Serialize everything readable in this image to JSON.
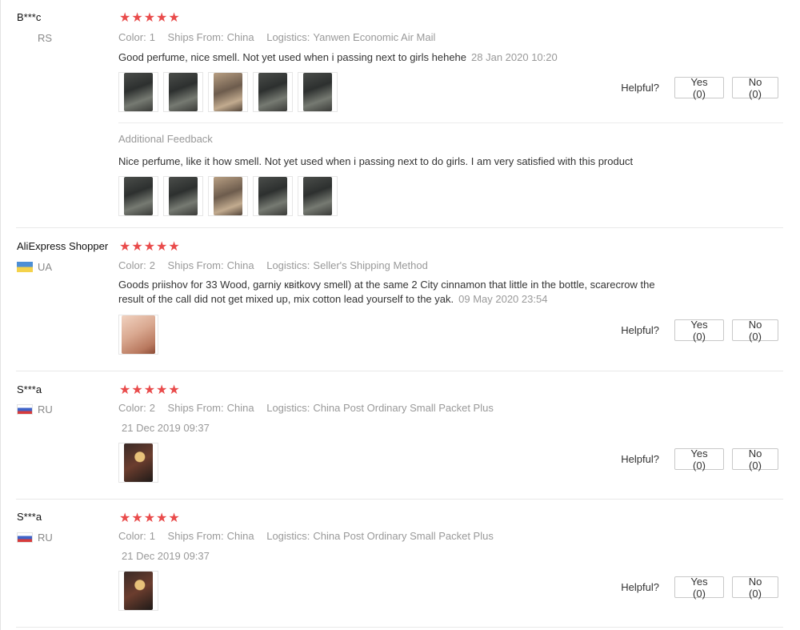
{
  "reviews": [
    {
      "user": "B***c",
      "country": "RS",
      "stars": "★★★★★",
      "color_label": "Color:",
      "color_value": "1",
      "ships_label": "Ships From:",
      "ships_value": "China",
      "logistics_label": "Logistics:",
      "logistics_value": "Yanwen Economic Air Mail",
      "text": "Good perfume, nice smell. Not yet used when i passing next to girls hehehe",
      "date": "28 Jan 2020 10:20",
      "helpful_label": "Helpful?",
      "yes_label": "Yes (0)",
      "no_label": "No (0)",
      "additional_label": "Additional Feedback",
      "additional_text": "Nice perfume, like it how smell. Not yet used when i passing next to do girls. I am very satisfied with this product"
    },
    {
      "user": "AliExpress Shopper",
      "country": "UA",
      "stars": "★★★★★",
      "color_label": "Color:",
      "color_value": "2",
      "ships_label": "Ships From:",
      "ships_value": "China",
      "logistics_label": "Logistics:",
      "logistics_value": "Seller's Shipping Method",
      "text_line1": "Goods priishov for 33 Wood, garniy квitkovy smell) at the same 2 City cinnamon that little in the bottle, scarecrow the",
      "text_line2": "result of the call did not get mixed up, mix cotton lead yourself to the yak.",
      "date": "09 May 2020 23:54",
      "helpful_label": "Helpful?",
      "yes_label": "Yes (0)",
      "no_label": "No (0)"
    },
    {
      "user": "S***a",
      "country": "RU",
      "stars": "★★★★★",
      "color_label": "Color:",
      "color_value": "2",
      "ships_label": "Ships From:",
      "ships_value": "China",
      "logistics_label": "Logistics:",
      "logistics_value": "China Post Ordinary Small Packet Plus",
      "date": "21 Dec 2019 09:37",
      "helpful_label": "Helpful?",
      "yes_label": "Yes (0)",
      "no_label": "No (0)"
    },
    {
      "user": "S***a",
      "country": "RU",
      "stars": "★★★★★",
      "color_label": "Color:",
      "color_value": "1",
      "ships_label": "Ships From:",
      "ships_value": "China",
      "logistics_label": "Logistics:",
      "logistics_value": "China Post Ordinary Small Packet Plus",
      "date": "21 Dec 2019 09:37",
      "helpful_label": "Helpful?",
      "yes_label": "Yes (0)",
      "no_label": "No (0)"
    }
  ],
  "rating_color": "#e94b4b",
  "rating": [
    5,
    5,
    5,
    5
  ]
}
